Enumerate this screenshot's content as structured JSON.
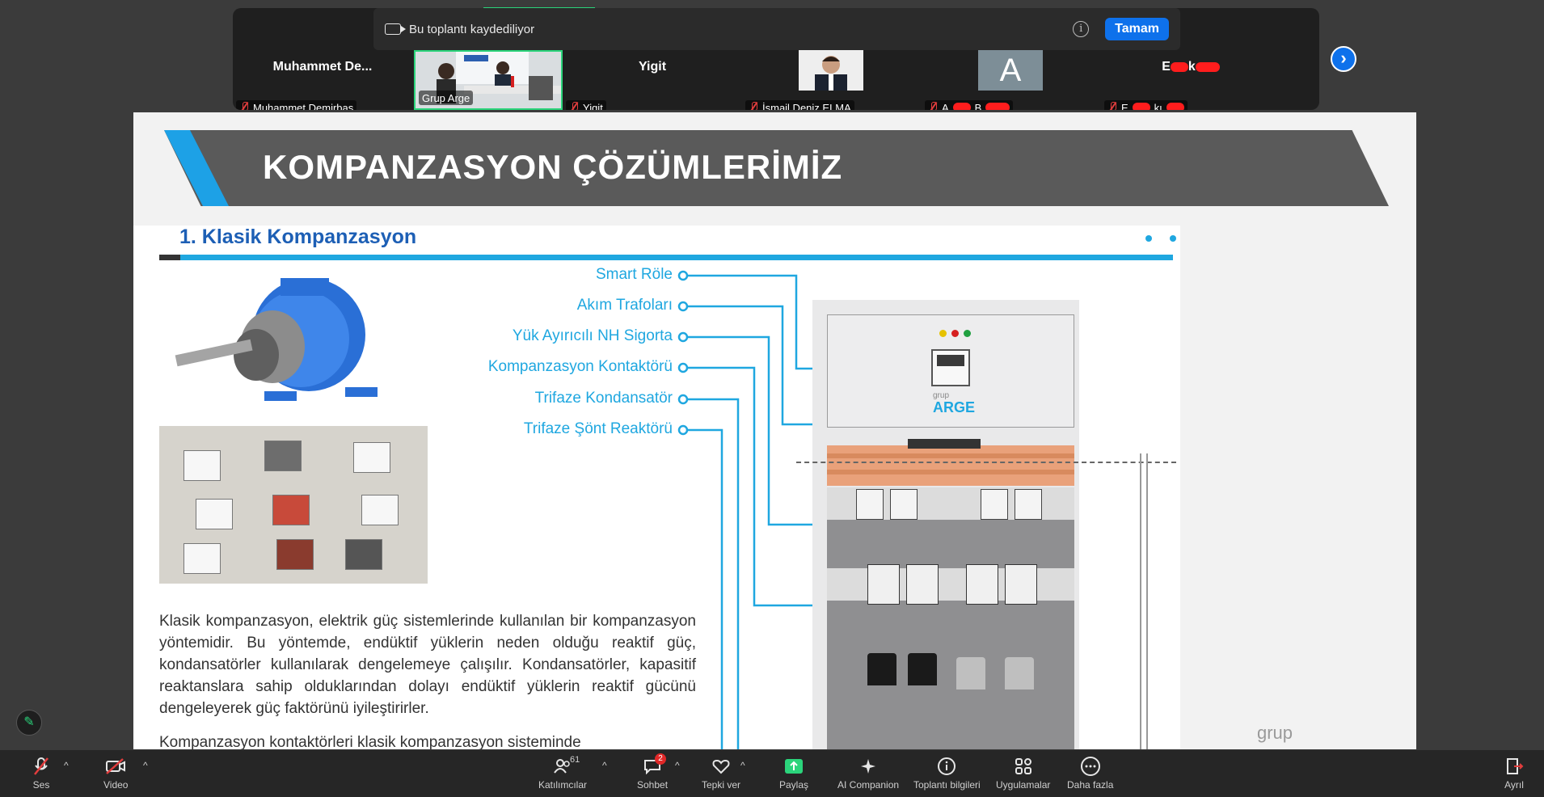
{
  "recording_banner": {
    "text": "Bu toplantı kaydediliyor",
    "ok_label": "Tamam"
  },
  "participants": [
    {
      "big_name": "Muhammet  De...",
      "footer": "Muhammet Demirbaş",
      "muted": true
    },
    {
      "big_name": "",
      "footer": "Grup Arge",
      "muted": false
    },
    {
      "big_name": "Yigit",
      "footer": "Yigit",
      "muted": true
    },
    {
      "big_name": "",
      "footer": "İsmail Deniz ELMA",
      "muted": true
    },
    {
      "big_name": "A",
      "footer": "A",
      "muted": true
    },
    {
      "big_name": "E",
      "footer": "E",
      "muted": true
    }
  ],
  "slide": {
    "title": "KOMPANZASYON ÇÖZÜMLERİMİZ",
    "section_title": "1. Klasik Kompanzasyon",
    "labels": [
      "Smart Röle",
      "Akım Trafoları",
      "Yük Ayırıcılı NH Sigorta",
      "Kompanzasyon Kontaktörü",
      "Trifaze Kondansatör",
      "Trifaze Şönt Reaktörü"
    ],
    "paragraph": "Klasik kompanzasyon, elektrik güç sistemlerinde kullanılan bir kompanzasyon yöntemidir. Bu yöntemde, endüktif yüklerin neden olduğu reaktif güç, kondansatörler kullanılarak dengelemeye çalışılır. Kondansatörler, kapasitif reaktanslara sahip olduklarından dolayı endüktif yüklerin reaktif gücünü dengeleyerek güç faktörünü iyileştirirler.",
    "paragraph2": "Kompanzasyon kontaktörleri klasik kompanzasyon sisteminde",
    "panel_logo_small": "grup",
    "panel_logo_big": "ARGE",
    "corner_logo": "grup"
  },
  "toolbar": {
    "audio": "Ses",
    "video": "Video",
    "participants": "Katılımcılar",
    "participants_count": "61",
    "chat": "Sohbet",
    "chat_badge": "2",
    "react": "Tepki ver",
    "share": "Paylaş",
    "ai": "AI Companion",
    "info": "Toplantı bilgileri",
    "apps": "Uygulamalar",
    "more": "Daha fazla",
    "leave": "Ayrıl"
  },
  "colors": {
    "accent": "#0e71eb",
    "slide_blue": "#1fa7e0",
    "muted_red": "#e23d3d",
    "share_green": "#2bd47b"
  }
}
